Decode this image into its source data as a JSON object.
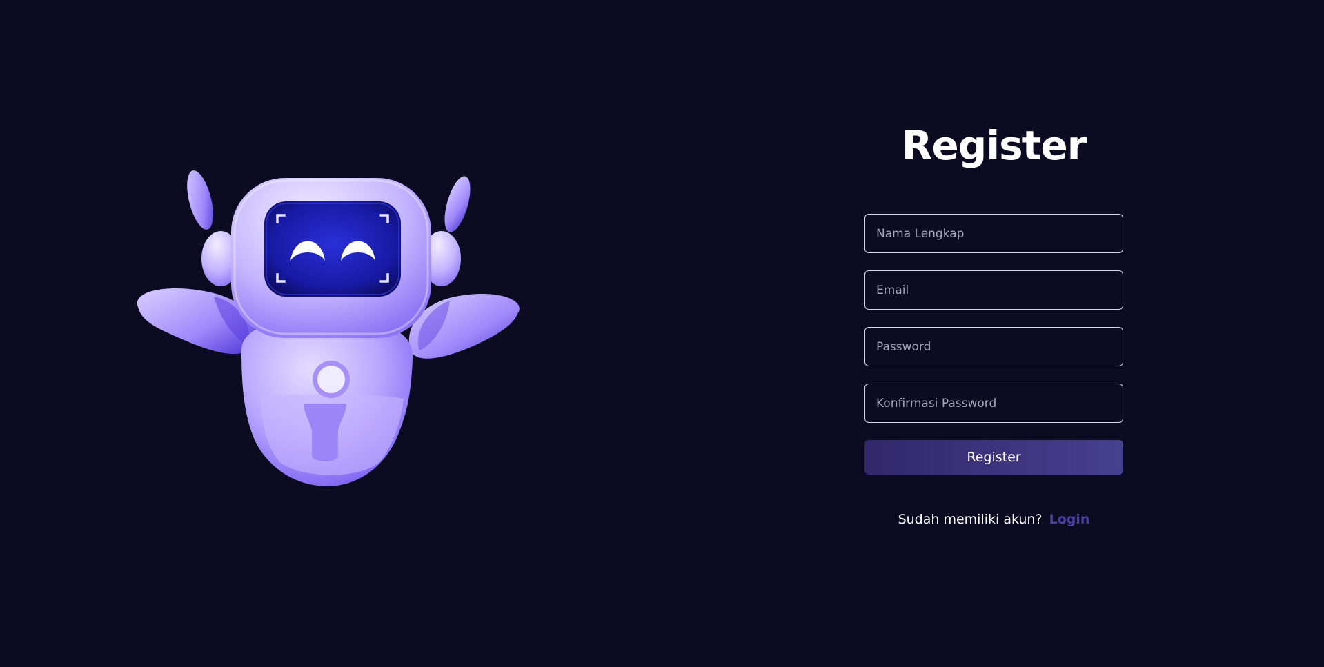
{
  "form": {
    "title": "Register",
    "fields": [
      {
        "placeholder": "Nama Lengkap",
        "value": ""
      },
      {
        "placeholder": "Email",
        "value": ""
      },
      {
        "placeholder": "Password",
        "value": ""
      },
      {
        "placeholder": "Konfirmasi Password",
        "value": ""
      }
    ],
    "submit_label": "Register",
    "login_prompt": "Sudah memiliki akun?",
    "login_link": "Login"
  },
  "colors": {
    "background": "#0b0b22",
    "accent": "#4e3fa3",
    "button_start": "#32276a",
    "button_end": "#47408f",
    "robot_body": "#a993fb"
  },
  "icons": {
    "illustration": "robot-mascot"
  }
}
